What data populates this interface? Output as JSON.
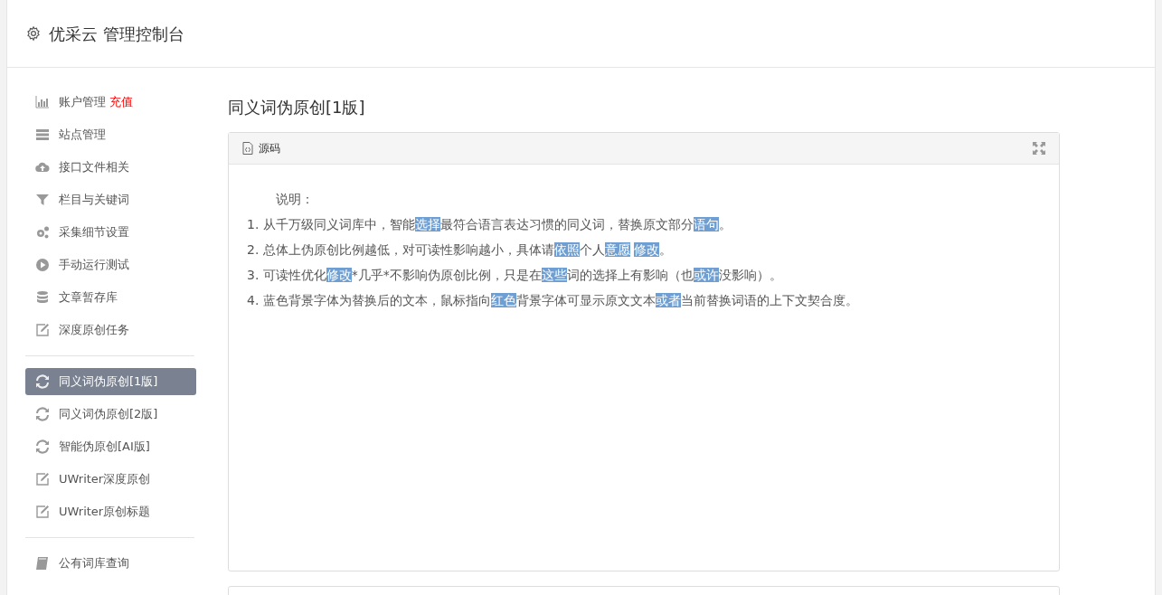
{
  "header": {
    "title": "优采云 管理控制台"
  },
  "sidebar": {
    "groups": [
      [
        {
          "label": "账户管理",
          "badge": "充值",
          "selected": false
        },
        {
          "label": "站点管理",
          "selected": false
        },
        {
          "label": "接口文件相关",
          "selected": false
        },
        {
          "label": "栏目与关键词",
          "selected": false
        },
        {
          "label": "采集细节设置",
          "selected": false
        },
        {
          "label": "手动运行测试",
          "selected": false
        },
        {
          "label": "文章暂存库",
          "selected": false
        },
        {
          "label": "深度原创任务",
          "selected": false
        }
      ],
      [
        {
          "label": "同义词伪原创[1版]",
          "selected": true
        },
        {
          "label": "同义词伪原创[2版]",
          "selected": false
        },
        {
          "label": "智能伪原创[AI版]",
          "selected": false
        },
        {
          "label": "UWriter深度原创",
          "selected": false
        },
        {
          "label": "UWriter原创标题",
          "selected": false
        }
      ],
      [
        {
          "label": "公有词库查询",
          "selected": false
        }
      ]
    ]
  },
  "main": {
    "title": "同义词伪原创[1版]",
    "panel": {
      "title": "源码",
      "heading": "说明：",
      "lines": [
        [
          {
            "text": "1. 从千万级同义词库中，智能"
          },
          {
            "text": "选择",
            "highlight": true
          },
          {
            "text": "最符合语言表达习惯的同义词，替换原文部分"
          },
          {
            "text": "语句",
            "highlight": true
          },
          {
            "text": "。"
          }
        ],
        [
          {
            "text": "2. 总体上伪原创比例越低，对可读性影响越小，具体请"
          },
          {
            "text": "依照",
            "highlight": true
          },
          {
            "text": "个人"
          },
          {
            "text": "意愿",
            "highlight": true
          },
          {
            "text": "修改",
            "highlight": true
          },
          {
            "text": "。"
          }
        ],
        [
          {
            "text": "3. 可读性优化"
          },
          {
            "text": "修改",
            "highlight": true
          },
          {
            "text": "*几乎*不影响伪原创比例，只是在"
          },
          {
            "text": "这些",
            "highlight": true
          },
          {
            "text": "词的选择上有影响（也"
          },
          {
            "text": "或许",
            "highlight": true
          },
          {
            "text": "没影响）。"
          }
        ],
        [
          {
            "text": "4. 蓝色背景字体为替换后的文本，鼠标指向"
          },
          {
            "text": "红色",
            "highlight": true
          },
          {
            "text": "背景字体可显示原文文本"
          },
          {
            "text": "或者",
            "highlight": true
          },
          {
            "text": "当前替换词语的上下文契合度。"
          }
        ]
      ]
    }
  }
}
